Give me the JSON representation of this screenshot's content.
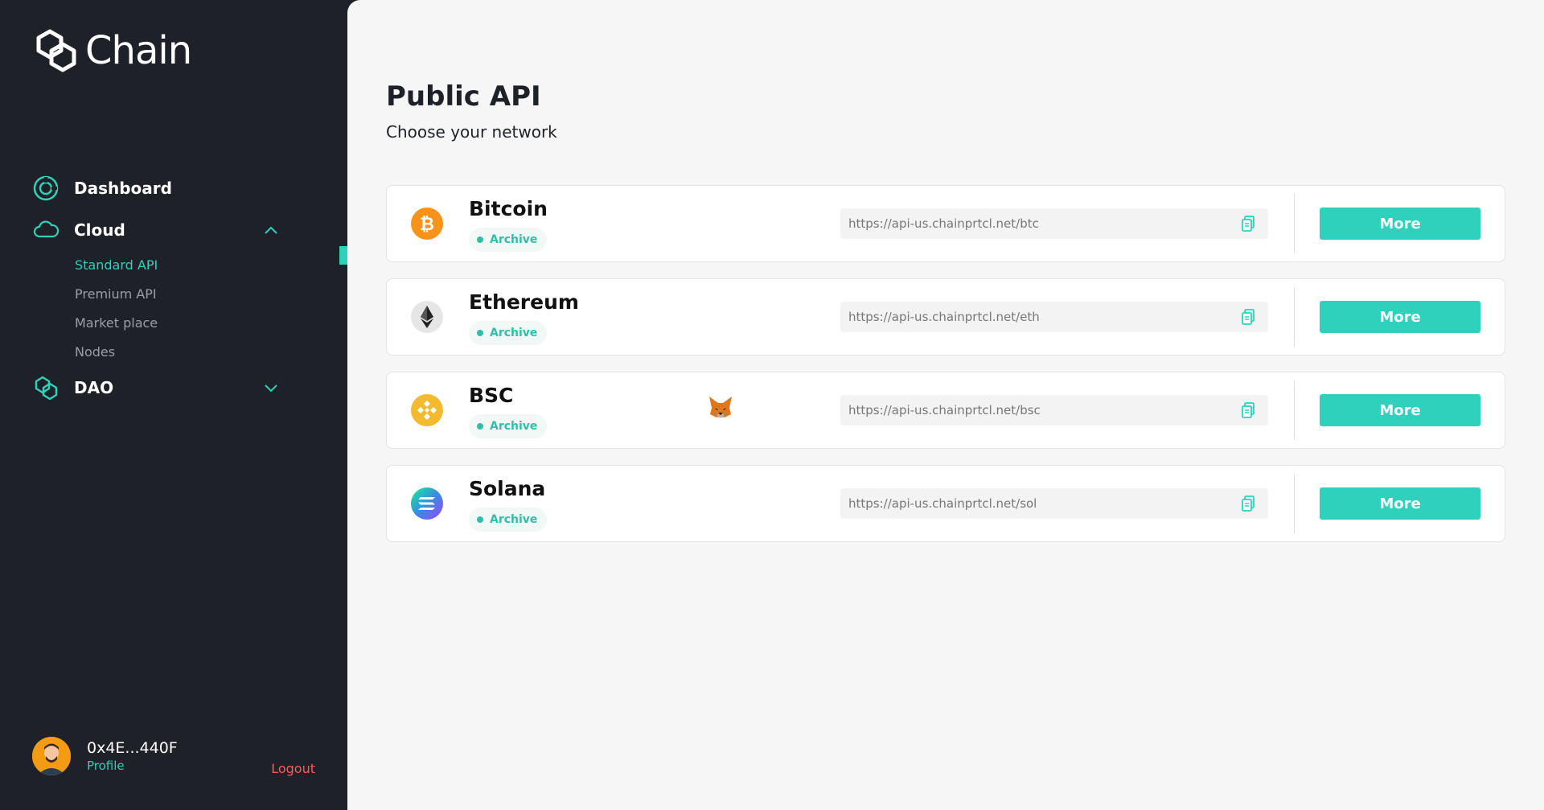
{
  "brand": {
    "name": "Chain"
  },
  "nav": {
    "dashboard": "Dashboard",
    "cloud": {
      "label": "Cloud",
      "items": [
        "Standard API",
        "Premium API",
        "Market place",
        "Nodes"
      ]
    },
    "dao": "DAO"
  },
  "profile": {
    "address": "0x4E...440F",
    "link": "Profile",
    "logout": "Logout"
  },
  "page": {
    "title": "Public API",
    "subtitle": "Choose your network"
  },
  "networks": [
    {
      "name": "Bitcoin",
      "badge": "Archive",
      "url": "https://api-us.chainprtcl.net/btc",
      "button": "More",
      "icon": "bitcoin-icon",
      "color": "#f7931a"
    },
    {
      "name": "Ethereum",
      "badge": "Archive",
      "url": "https://api-us.chainprtcl.net/eth",
      "button": "More",
      "icon": "ethereum-icon",
      "color": "#dcdcdc"
    },
    {
      "name": "BSC",
      "badge": "Archive",
      "url": "https://api-us.chainprtcl.net/bsc",
      "button": "More",
      "icon": "bnb-icon",
      "color": "#f3ba2f"
    },
    {
      "name": "Solana",
      "badge": "Archive",
      "url": "https://api-us.chainprtcl.net/sol",
      "button": "More",
      "icon": "solana-icon",
      "color": "#9945ff"
    }
  ],
  "colors": {
    "accent": "#2fd1bc",
    "sidebar": "#1e2128",
    "logout": "#ff5a5a"
  }
}
